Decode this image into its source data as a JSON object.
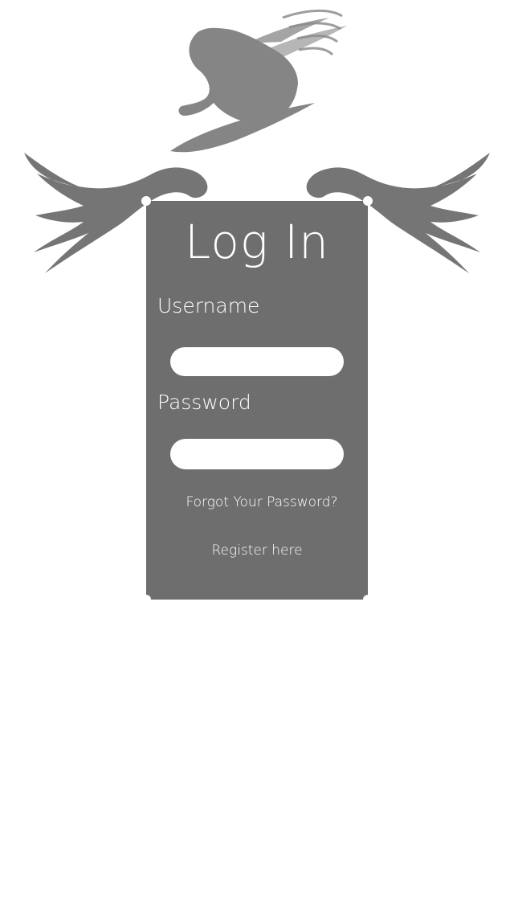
{
  "login": {
    "title": "Log In",
    "username_label": "Username",
    "password_label": "Password",
    "username_value": "",
    "password_value": "",
    "forgot_link": "Forgot Your Password?",
    "register_link": "Register here"
  },
  "colors": {
    "card": "#6e6e6e",
    "art": "#7a7a7a",
    "background": "#ffffff",
    "text": "#ffffff"
  }
}
